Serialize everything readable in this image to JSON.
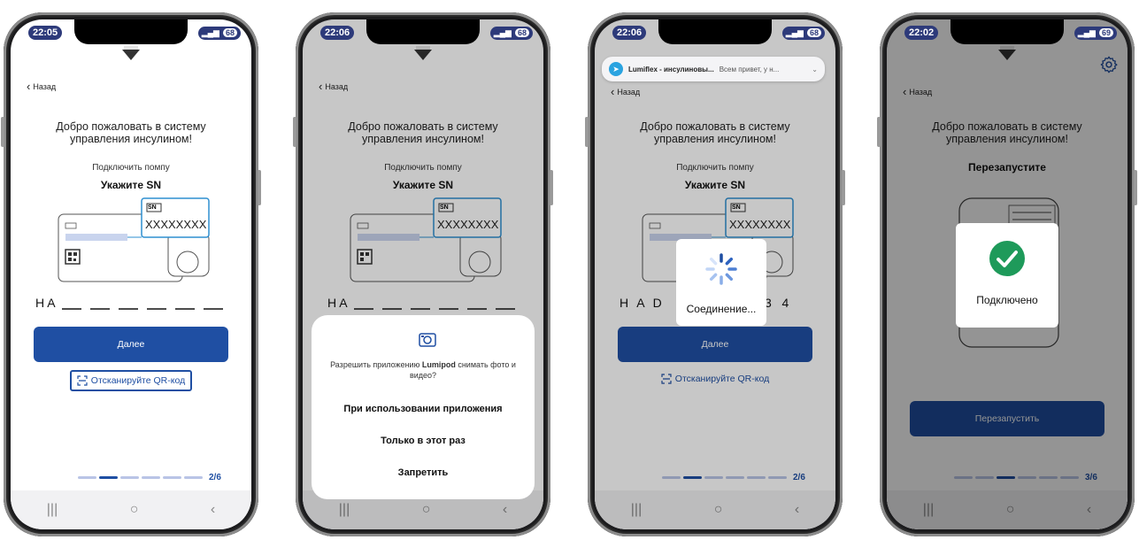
{
  "phones": [
    {
      "time": "22:05",
      "battery": "68",
      "back": "Назад",
      "welcome": "Добро пожаловать в систему управления инсулином!",
      "connect": "Подключить помпу",
      "subtitle": "Укажите SN",
      "sn_label": "SN",
      "sn_value": "XXXXXXXX",
      "serial_prefix": "H A",
      "button": "Далее",
      "qr_link": "Отсканируйте QR-код",
      "progress": "2/6"
    },
    {
      "time": "22:06",
      "battery": "68",
      "back": "Назад",
      "welcome": "Добро пожаловать в систему управления инсулином!",
      "connect": "Подключить помпу",
      "subtitle": "Укажите SN",
      "sn_label": "SN",
      "sn_value": "XXXXXXXX",
      "serial_prefix": "H A",
      "permission": {
        "message_before": "Разрешить приложению ",
        "app_name": "Lumipod",
        "message_after": " снимать фото и видео?",
        "option_1": "При использовании приложения",
        "option_2": "Только в этот раз",
        "option_3": "Запретить"
      }
    },
    {
      "time": "22:06",
      "battery": "68",
      "notification": {
        "title": "Lumiflex - инсулиновы...",
        "text": "Всем привет, у н..."
      },
      "back": "Назад",
      "welcome": "Добро пожаловать в систему управления инсулином!",
      "connect": "Подключить помпу",
      "subtitle": "Укажите SN",
      "sn_label": "SN",
      "sn_value": "XXXXXXXX",
      "serial_left": "H A D",
      "serial_right": "3   4",
      "loading": "Соединение...",
      "button": "Далее",
      "qr_link": "Отсканируйте QR-код",
      "progress": "2/6"
    },
    {
      "time": "22:02",
      "battery": "69",
      "back": "Назад",
      "welcome": "Добро пожаловать в систему управления инсулином!",
      "subtitle": "Перезапустите",
      "connected": "Подключено",
      "button": "Перезапустить",
      "progress": "3/6"
    }
  ],
  "colors": {
    "primary": "#1f4fa3",
    "primary_light": "#b9c4e6",
    "success": "#1e9a5a",
    "sn_border": "#2e8fd0"
  }
}
